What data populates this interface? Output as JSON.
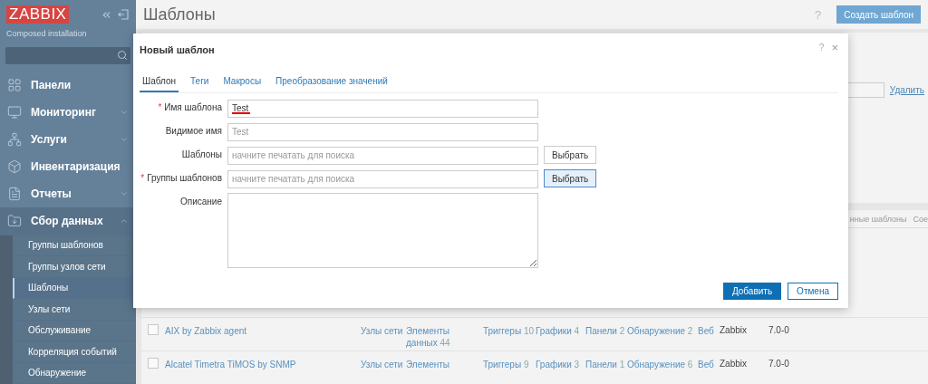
{
  "sidebar": {
    "logo": "ZABBIX",
    "subtitle": "Composed installation",
    "menu": [
      {
        "label": "Панели",
        "kind": "link",
        "expanded": false
      },
      {
        "label": "Мониторинг",
        "kind": "group",
        "expanded": false
      },
      {
        "label": "Услуги",
        "kind": "group",
        "expanded": false
      },
      {
        "label": "Инвентаризация",
        "kind": "group",
        "expanded": false
      },
      {
        "label": "Отчеты",
        "kind": "group",
        "expanded": false
      },
      {
        "label": "Сбор данных",
        "kind": "group",
        "expanded": true,
        "children": [
          {
            "label": "Группы шаблонов",
            "selected": false
          },
          {
            "label": "Группы узлов сети",
            "selected": false
          },
          {
            "label": "Шаблоны",
            "selected": true
          },
          {
            "label": "Узлы сети",
            "selected": false
          },
          {
            "label": "Обслуживание",
            "selected": false
          },
          {
            "label": "Корреляция событий",
            "selected": false
          },
          {
            "label": "Обнаружение",
            "selected": false
          }
        ]
      }
    ]
  },
  "page": {
    "title": "Шаблоны",
    "help": "?",
    "create_button": "Создать шаблон"
  },
  "filter": {
    "remove_link": "Удалить"
  },
  "table": {
    "header": [
      "нные шаблоны",
      "Сое"
    ],
    "rows": [
      {
        "checked": false,
        "name": "AIX by Zabbix agent",
        "hosts": "Узлы сети",
        "items": {
          "label": "Элементы данных",
          "count": "44"
        },
        "triggers": {
          "label": "Триггеры",
          "count": "10"
        },
        "graphs": {
          "label": "Графики",
          "count": "4"
        },
        "dashboards": {
          "label": "Панели",
          "count": "2"
        },
        "discovery": {
          "label": "Обнаружение",
          "count": "2"
        },
        "web": "Веб",
        "vendor": "Zabbix",
        "version": "7.0-0"
      },
      {
        "checked": false,
        "name": "Alcatel Timetra TiMOS by SNMP",
        "hosts": "Узлы сети",
        "items": {
          "label": "Элементы"
        },
        "triggers": {
          "label": "Триггеры",
          "count": "9"
        },
        "graphs": {
          "label": "Графики",
          "count": "3"
        },
        "dashboards": {
          "label": "Панели",
          "count": "1"
        },
        "discovery": {
          "label": "Обнаружение",
          "count": "6"
        },
        "web": "Веб",
        "vendor": "Zabbix",
        "version": "7.0-0"
      }
    ]
  },
  "modal": {
    "title": "Новый шаблон",
    "help": "?",
    "close": "×",
    "tabs": [
      {
        "label": "Шаблон",
        "selected": true
      },
      {
        "label": "Теги",
        "selected": false
      },
      {
        "label": "Макросы",
        "selected": false
      },
      {
        "label": "Преобразование значений",
        "selected": false
      }
    ],
    "fields": [
      {
        "label": "Имя шаблона",
        "required_mark": "*",
        "kind": "text",
        "value": "Test",
        "spell_error": true
      },
      {
        "label": "Видимое имя",
        "kind": "text",
        "placeholder": "Test"
      },
      {
        "label": "Шаблоны",
        "kind": "multiselect",
        "placeholder": "начните печатать для поиска",
        "button": "Выбрать",
        "button_focused": false
      },
      {
        "label": "Группы шаблонов",
        "required_mark": "*",
        "kind": "multiselect",
        "placeholder": "начните печатать для поиска",
        "button": "Выбрать",
        "button_focused": true
      },
      {
        "label": "Описание",
        "kind": "textarea"
      }
    ],
    "buttons": [
      {
        "label": "Добавить",
        "kind": "primary"
      },
      {
        "label": "Отмена",
        "kind": "secondary"
      }
    ]
  }
}
